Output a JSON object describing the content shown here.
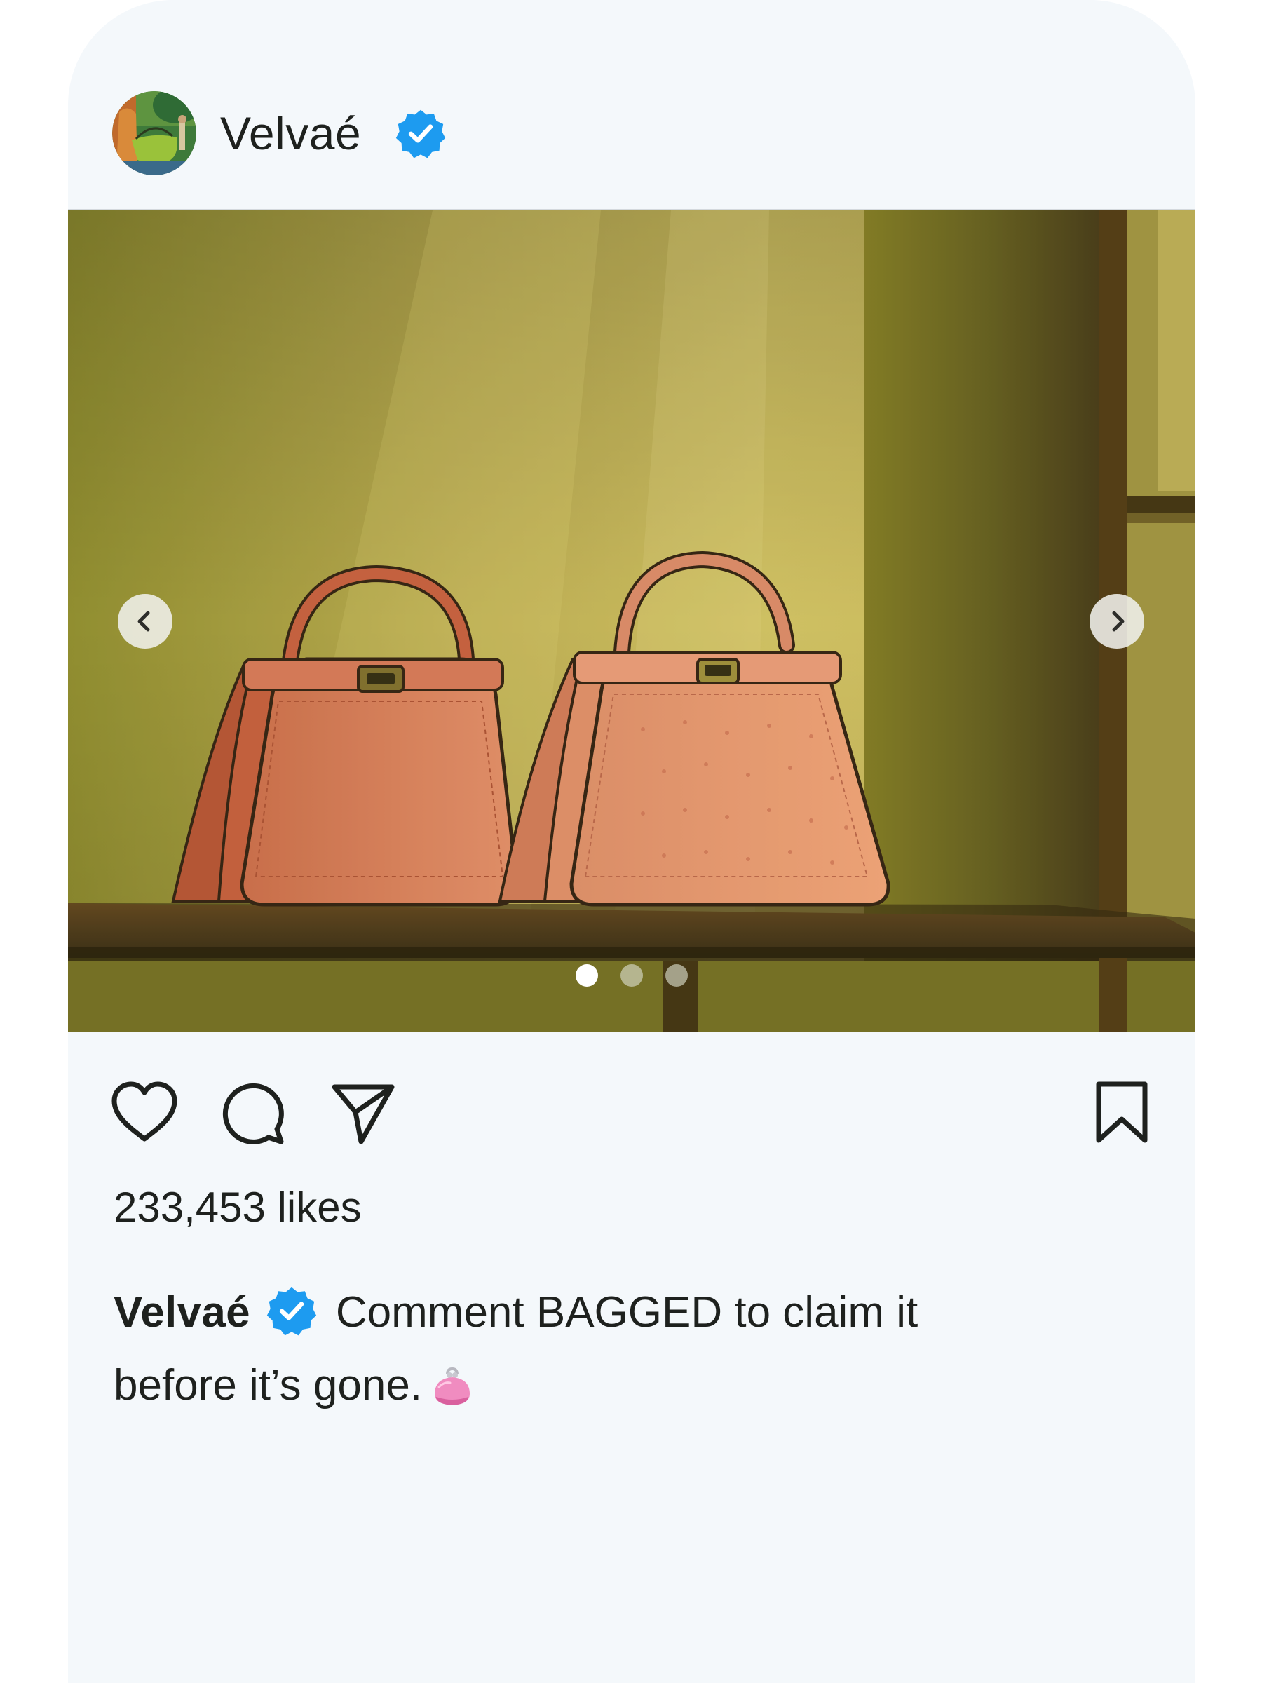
{
  "post": {
    "username": "Velvaé",
    "verified": true,
    "likes_text": "233,453 likes",
    "caption_part1": "Comment BAGGED to claim it",
    "caption_part2": "before it’s gone.",
    "caption_emoji": "purse-icon"
  },
  "carousel": {
    "slide_count": 3,
    "active_slide": 1
  },
  "icons": {
    "verified": "verified-badge-icon",
    "like": "heart-icon",
    "comment": "comment-bubble-icon",
    "share": "paper-plane-icon",
    "save": "bookmark-icon",
    "prev": "chevron-left-icon",
    "next": "chevron-right-icon"
  },
  "colors": {
    "card_background": "#f4f8fb",
    "verified_blue": "#1d9bf0",
    "text": "#1e211e"
  }
}
